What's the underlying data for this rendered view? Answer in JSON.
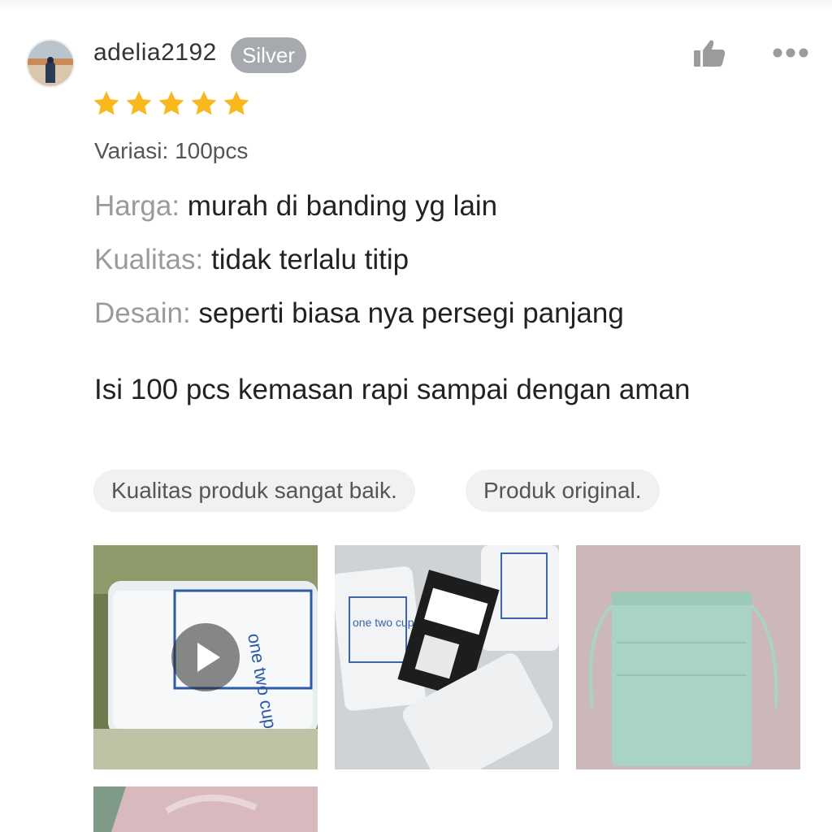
{
  "review": {
    "username": "adelia2192",
    "badge": "Silver",
    "rating": 5,
    "variation": "Variasi: 100pcs",
    "attributes": [
      {
        "label": "Harga:",
        "value": " murah di banding yg lain"
      },
      {
        "label": "Kualitas:",
        "value": " tidak terlalu titip"
      },
      {
        "label": "Desain:",
        "value": " seperti biasa nya persegi panjang"
      }
    ],
    "body": "Isi 100 pcs kemasan rapi sampai dengan aman",
    "tags": [
      "Kualitas produk sangat baik.",
      "Produk original."
    ]
  },
  "media": {
    "thumbnails": [
      {
        "kind": "video",
        "print_brand": "one two cups"
      },
      {
        "kind": "image",
        "print_brand": "one two cups"
      },
      {
        "kind": "image"
      },
      {
        "kind": "image"
      }
    ]
  },
  "colors": {
    "star": "#f8b81e",
    "badge": "#a6a9ad",
    "icon": "#9b9b9b"
  },
  "icons": [
    "like-icon",
    "more-options-icon",
    "star-icon",
    "play-icon"
  ]
}
